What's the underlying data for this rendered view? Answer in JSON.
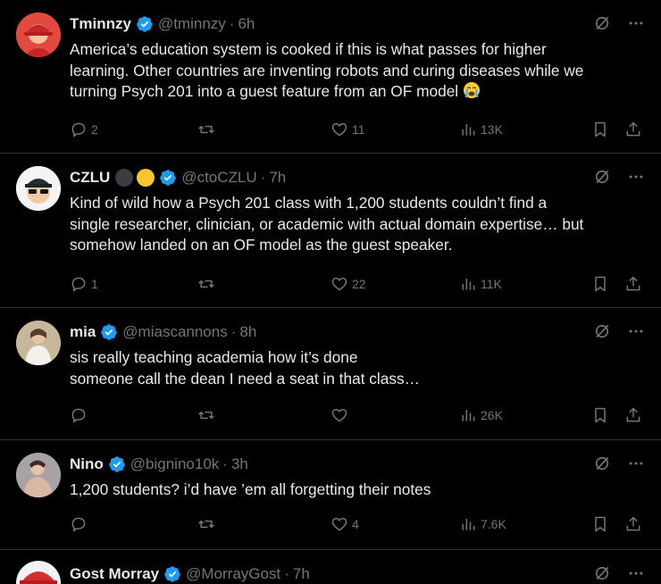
{
  "colors": {
    "background": "#000000",
    "text": "#e7e9ea",
    "muted": "#71767b",
    "verified": "#1d9bf0",
    "divider": "#2f3336"
  },
  "icons": {
    "verified": "verified-badge-icon",
    "grok": "grok-icon",
    "more": "more-icon",
    "reply": "reply-icon",
    "retweet": "retweet-icon",
    "like": "like-icon",
    "views": "views-icon",
    "bookmark": "bookmark-icon",
    "share": "share-icon",
    "emoji": "loudly-crying-face-icon"
  },
  "tweets": [
    {
      "name": "Tminnzy",
      "handle": "@tminnzy",
      "time": "6h",
      "lines": [
        "America’s education system is cooked if this is what passes for higher",
        "learning. Other countries are inventing robots and curing diseases while we",
        "turning Psych 201 into a guest feature from an OF model"
      ],
      "replies": "2",
      "retweets": "",
      "likes": "11",
      "views": "13K"
    },
    {
      "name": "CZLU",
      "handle": "@ctoCZLU",
      "time": "7h",
      "lines": [
        "Kind of wild how a Psych 201 class with 1,200 students couldn’t find a",
        "single researcher, clinician, or academic with actual domain expertise… but",
        "somehow landed on an OF model as the guest speaker."
      ],
      "replies": "1",
      "retweets": "",
      "likes": "22",
      "views": "11K"
    },
    {
      "name": "mia",
      "handle": "@miascannons",
      "time": "8h",
      "lines": [
        "sis really teaching academia how it’s done",
        "someone call the dean I need a seat in that class…"
      ],
      "replies": "",
      "retweets": "",
      "likes": "",
      "views": "26K"
    },
    {
      "name": "Nino",
      "handle": "@bignino10k",
      "time": "3h",
      "lines": [
        "1,200 students? i’d have ’em all forgetting their notes"
      ],
      "replies": "",
      "retweets": "",
      "likes": "4",
      "views": "7.6K"
    },
    {
      "name": "Gost Morray",
      "handle": "@MorrayGost",
      "time": "7h"
    }
  ]
}
